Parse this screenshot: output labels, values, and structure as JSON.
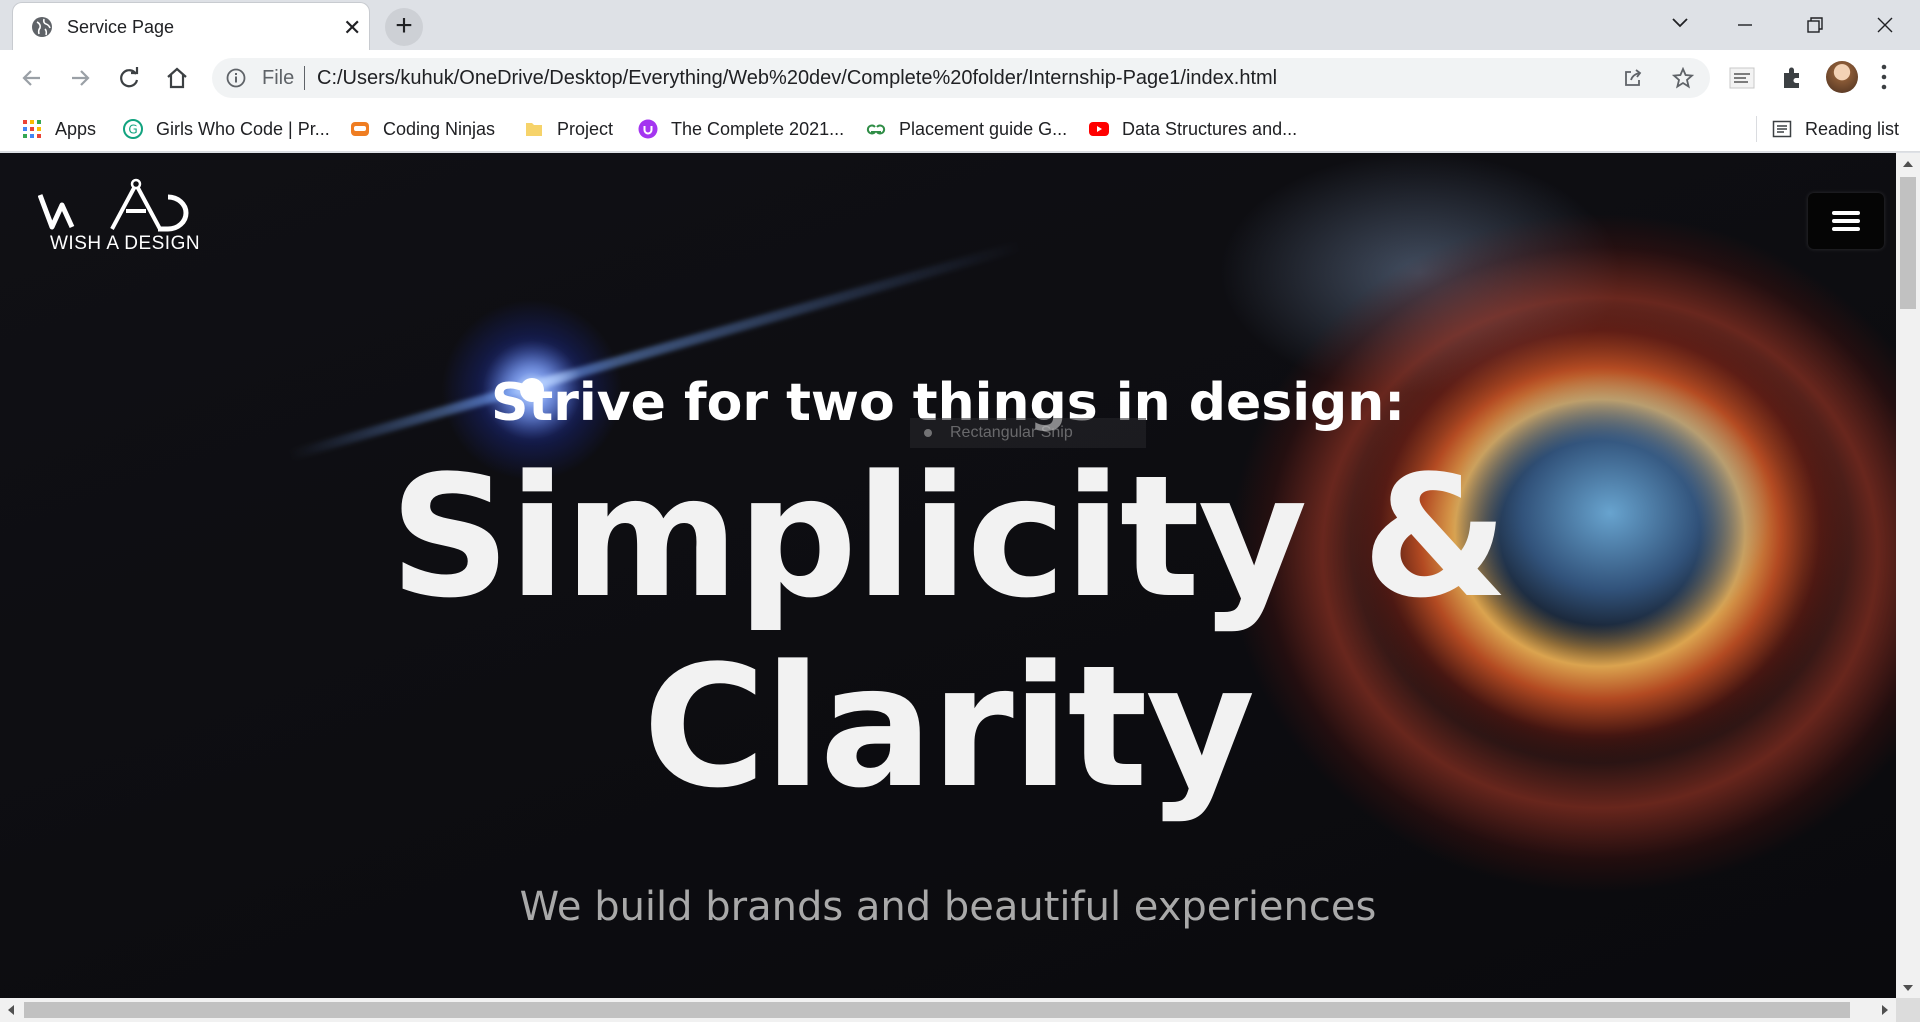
{
  "browser": {
    "tab": {
      "title": "Service Page"
    },
    "address": {
      "scheme_label": "File",
      "url": "C:/Users/kuhuk/OneDrive/Desktop/Everything/Web%20dev/Complete%20folder/Internship-Page1/index.html"
    },
    "bookmarks": [
      {
        "label": "Apps",
        "icon": "apps-grid-icon",
        "color": "#ea4335"
      },
      {
        "label": "Girls Who Code | Pr...",
        "icon": "girls-who-code-icon",
        "color": "#12a37f"
      },
      {
        "label": "Coding Ninjas",
        "icon": "coding-ninjas-icon",
        "color": "#ef7d22"
      },
      {
        "label": "Project",
        "icon": "folder-icon",
        "color": "#f6d36a"
      },
      {
        "label": "The Complete 2021...",
        "icon": "udemy-icon",
        "color": "#a435f0"
      },
      {
        "label": "Placement guide G...",
        "icon": "geeksforgeeks-icon",
        "color": "#2f8d46"
      },
      {
        "label": "Data Structures and...",
        "icon": "youtube-icon",
        "color": "#ff0000"
      }
    ],
    "reading_list": {
      "label": "Reading list",
      "icon": "reading-list-icon"
    }
  },
  "page": {
    "logo": {
      "text": "WISH A DESIGN"
    },
    "tagline": "Strive for two things in design:",
    "tooltip": "Rectangular Snip",
    "headline_line1": "Simplicity &",
    "headline_line2": "Clarity",
    "subline": "We build brands and beautiful experiences",
    "menu_icon": "hamburger-menu-icon"
  },
  "colors": {
    "chrome_bg": "#dee1e6",
    "page_bg": "#0b0b0f",
    "heading": "#f2f2f2",
    "subtext": "#a9a9a9"
  }
}
